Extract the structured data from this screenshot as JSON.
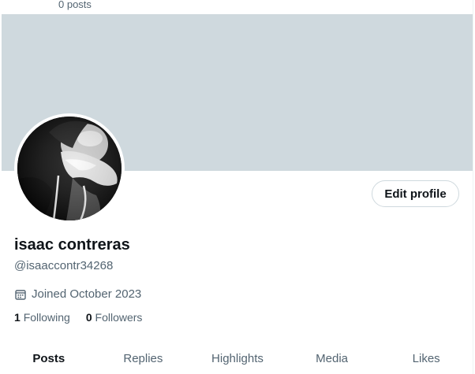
{
  "header": {
    "posts_count": "0 posts"
  },
  "profile": {
    "display_name": "isaac contreras",
    "handle": "@isaaccontr34268",
    "joined": "Joined October 2023",
    "edit_profile_label": "Edit profile",
    "banner_color": "#cfd9de",
    "following": {
      "count": "1",
      "label": "Following"
    },
    "followers": {
      "count": "0",
      "label": "Followers"
    },
    "icons": {
      "joined": "calendar-icon"
    }
  },
  "tabs": [
    {
      "label": "Posts",
      "active": true
    },
    {
      "label": "Replies",
      "active": false
    },
    {
      "label": "Highlights",
      "active": false
    },
    {
      "label": "Media",
      "active": false
    },
    {
      "label": "Likes",
      "active": false
    }
  ],
  "colors": {
    "text_primary": "#0f1419",
    "text_secondary": "#536471",
    "border": "#cfd9de"
  }
}
